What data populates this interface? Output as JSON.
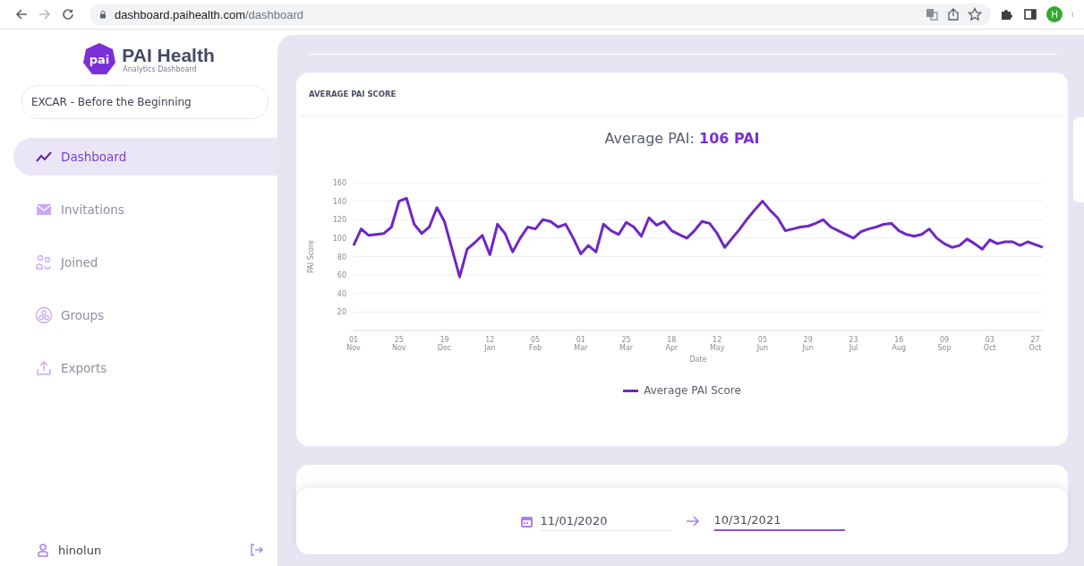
{
  "browser": {
    "url_host": "dashboard.paihealth.com",
    "url_path": "/dashboard",
    "profile_initial": "H"
  },
  "sidebar": {
    "brand": "PAI Health",
    "brand_subtitle": "Analytics Dashboard",
    "logo_text": "pai",
    "program": "EXCAR - Before the Beginning",
    "items": [
      {
        "label": "Dashboard",
        "kind": "trend",
        "selected": true
      },
      {
        "label": "Invitations",
        "kind": "mail",
        "selected": false
      },
      {
        "label": "Joined",
        "kind": "people",
        "selected": false
      },
      {
        "label": "Groups",
        "kind": "groups",
        "selected": false
      },
      {
        "label": "Exports",
        "kind": "upload",
        "selected": false
      }
    ],
    "user": "hinolun"
  },
  "average_card": {
    "title": "AVERAGE PAI SCORE",
    "summary_label": "Average PAI:",
    "summary_value": "106 PAI",
    "chart_data": {
      "type": "line",
      "xlabel": "Date",
      "ylabel": "PAI Score",
      "ylim": [
        0,
        160
      ],
      "grid": true,
      "yticks": [
        20,
        40,
        60,
        80,
        100,
        120,
        140,
        160
      ],
      "categories": [
        "01 Nov",
        null,
        null,
        null,
        null,
        null,
        "25 Nov",
        null,
        null,
        null,
        null,
        null,
        "19 Dec",
        null,
        null,
        null,
        null,
        null,
        "12 Jan",
        null,
        null,
        null,
        null,
        null,
        "05 Feb",
        null,
        null,
        null,
        null,
        null,
        "01 Mar",
        null,
        null,
        null,
        null,
        null,
        "25 Mar",
        null,
        null,
        null,
        null,
        null,
        "18 Apr",
        null,
        null,
        null,
        null,
        null,
        "12 May",
        null,
        null,
        null,
        null,
        null,
        "05 Jun",
        null,
        null,
        null,
        null,
        null,
        "29 Jun",
        null,
        null,
        null,
        null,
        null,
        "23 Jul",
        null,
        null,
        null,
        null,
        null,
        "16 Aug",
        null,
        null,
        null,
        null,
        null,
        "09 Sep",
        null,
        null,
        null,
        null,
        null,
        "03 Oct",
        null,
        null,
        null,
        null,
        null,
        "27 Oct",
        null
      ],
      "series": [
        {
          "name": "Average PAI Score",
          "color": "#6e27c5",
          "values": [
            92,
            110,
            103,
            104,
            105,
            112,
            140,
            143,
            115,
            105,
            112,
            133,
            118,
            88,
            58,
            88,
            95,
            103,
            82,
            115,
            105,
            85,
            100,
            112,
            110,
            120,
            118,
            112,
            115,
            100,
            83,
            92,
            85,
            115,
            108,
            104,
            117,
            112,
            102,
            122,
            114,
            118,
            108,
            104,
            100,
            108,
            118,
            116,
            105,
            90,
            100,
            110,
            121,
            131,
            140,
            130,
            122,
            108,
            110,
            112,
            113,
            116,
            120,
            112,
            108,
            104,
            100,
            107,
            110,
            112,
            115,
            116,
            108,
            104,
            102,
            104,
            110,
            100,
            94,
            90,
            92,
            99,
            94,
            88,
            98,
            94,
            96,
            96,
            92,
            96,
            93,
            90
          ]
        }
      ]
    }
  },
  "date_range": {
    "start": "11/01/2020",
    "end": "10/31/2021",
    "start_active": false,
    "end_active": true
  }
}
